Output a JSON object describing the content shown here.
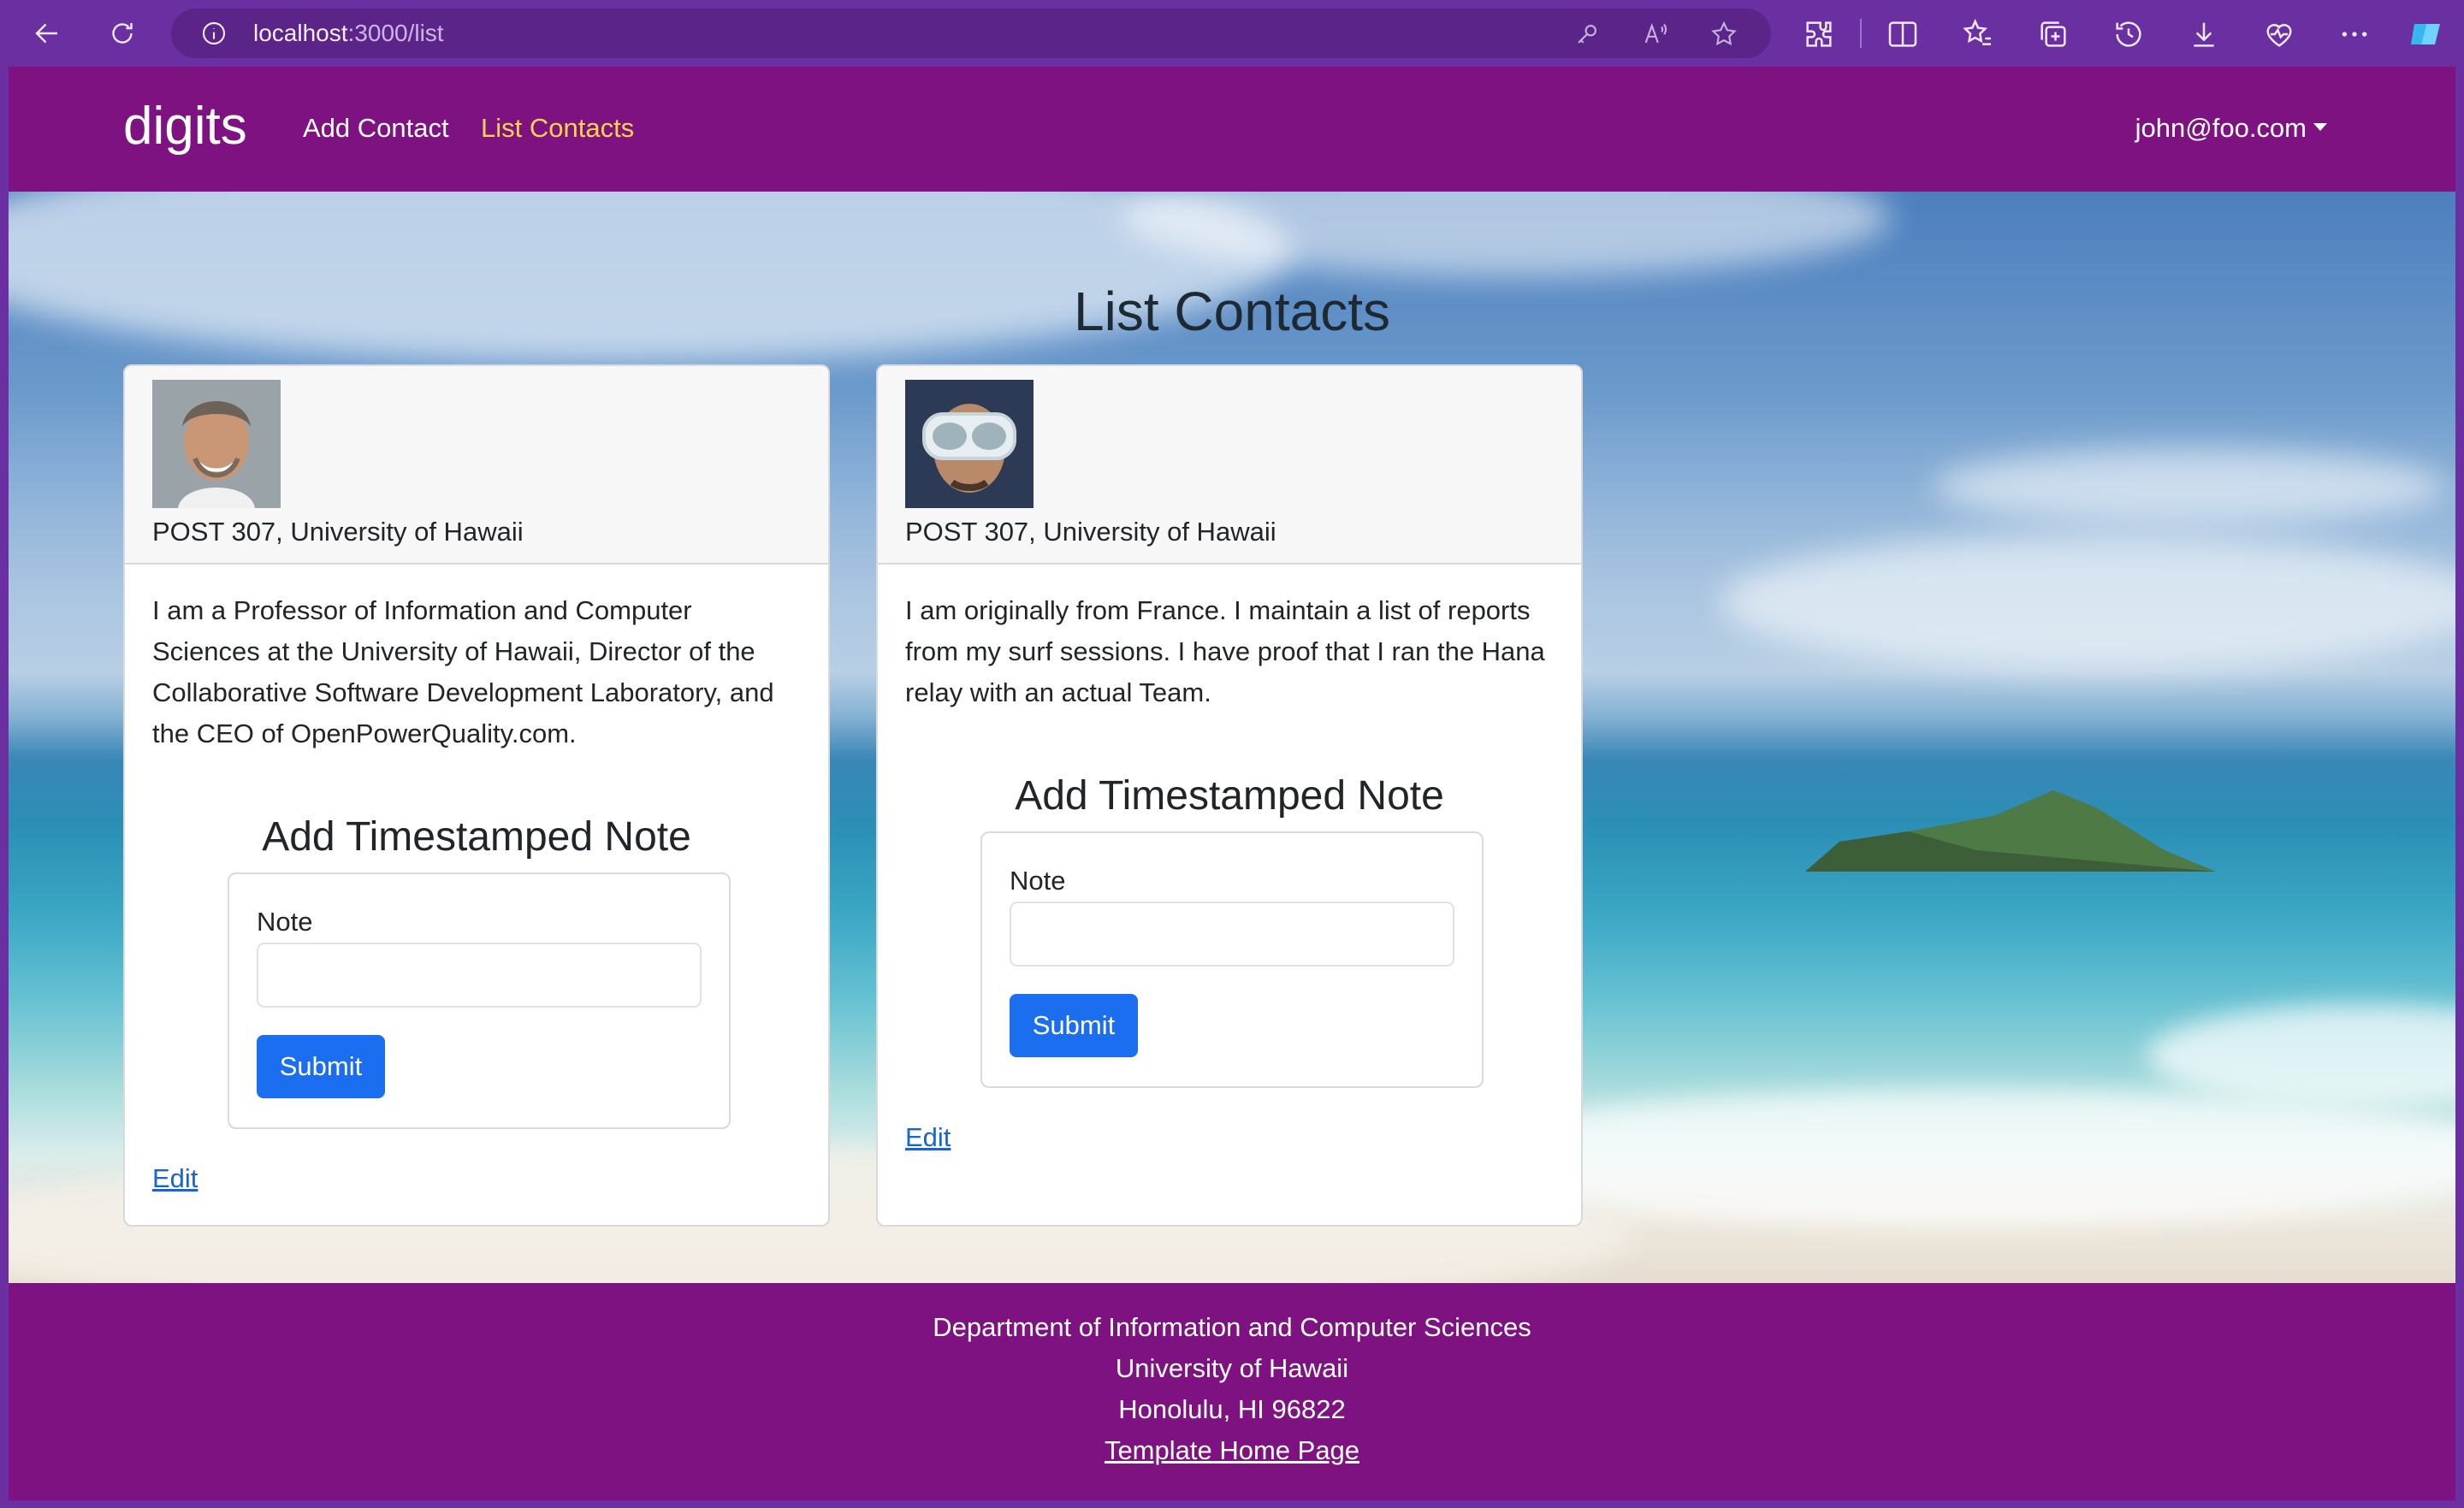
{
  "browser": {
    "url_host": "localhost",
    "url_path": ":3000/list"
  },
  "navbar": {
    "brand": "digits",
    "links": [
      {
        "label": "Add Contact",
        "active": false
      },
      {
        "label": "List Contacts",
        "active": true
      }
    ],
    "user": "john@foo.com"
  },
  "page": {
    "title": "List Contacts"
  },
  "contacts": [
    {
      "address": "POST 307, University of Hawaii",
      "bio": "I am a Professor of Information and Computer Sciences at the University of Hawaii, Director of the Collaborative Software Development Laboratory, and the CEO of OpenPowerQuality.com.",
      "note_title": "Add Timestamped Note",
      "note_label": "Note",
      "note_value": "",
      "submit_label": "Submit",
      "edit_label": "Edit"
    },
    {
      "address": "POST 307, University of Hawaii",
      "bio": "I am originally from France. I maintain a list of reports from my surf sessions. I have proof that I ran the Hana relay with an actual Team.",
      "note_title": "Add Timestamped Note",
      "note_label": "Note",
      "note_value": "",
      "submit_label": "Submit",
      "edit_label": "Edit"
    }
  ],
  "footer": {
    "line1": "Department of Information and Computer Sciences",
    "line2": "University of Hawaii",
    "line3": "Honolulu, HI 96822",
    "link": "Template Home Page"
  },
  "colors": {
    "nav_bg": "#7f1281",
    "active_link": "#ffd54a",
    "submit_bg": "#1b6ef0",
    "link": "#1763d9"
  }
}
